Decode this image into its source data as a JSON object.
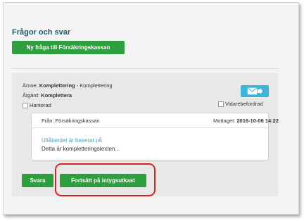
{
  "header": {
    "title": "Frågor och svar",
    "new_question_label": "Ny fråga till Försäkringskassan"
  },
  "question": {
    "subject_label": "Ämne:",
    "subject_value": "Komplettering",
    "subject_sub": "- Komplettering",
    "action_label": "Åtgärd:",
    "action_value": "Komplettera",
    "handled_label": "Hanterad",
    "forwarded_label": "Vidarebefordrad",
    "envelope_icon": "envelope-forward-icon"
  },
  "message": {
    "from": "Från: Försäkringskassan",
    "received_label": "Mottaget:",
    "received_value": "2016-10-06 14:22",
    "link_text": "Utlåtandet är baserat på",
    "body": "Detta är kompletteringstexten..."
  },
  "actions": {
    "reply_label": "Svara",
    "continue_label": "Fortsätt på intygsutkast"
  },
  "colors": {
    "accent_green": "#2e9e3e",
    "heading": "#1f5a6b",
    "link": "#3aa6c9",
    "highlight": "#e02020",
    "envelope_bg": "#3bb6d6"
  }
}
